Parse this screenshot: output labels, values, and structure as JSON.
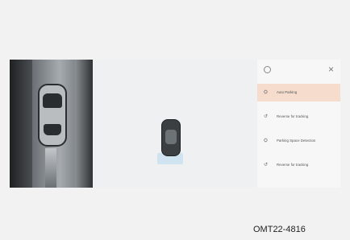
{
  "panel": {
    "close_icon": "close-icon",
    "settings_icon": "gear-icon",
    "items": [
      {
        "label": "Auto Parking",
        "icon": "car-icon",
        "active": true
      },
      {
        "label": "Reverse for tracking",
        "icon": "reverse-icon",
        "active": false
      },
      {
        "label": "Parking Space Detection",
        "icon": "car-icon",
        "active": false
      },
      {
        "label": "Reverse for tracking",
        "icon": "reverse-icon",
        "active": false
      }
    ]
  },
  "caption": "OMT22-4816",
  "colors": {
    "active_item": "#f5dccd",
    "highlight": "#cfe3f0"
  }
}
